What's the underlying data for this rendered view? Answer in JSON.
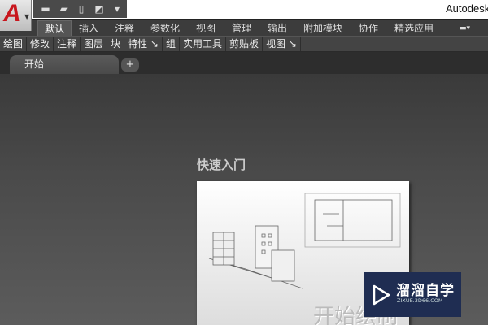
{
  "app": {
    "logo": "A",
    "title": "Autodesk"
  },
  "qat": {
    "icons": [
      "new-file-icon",
      "open-folder-icon",
      "save-icon",
      "plot-icon",
      "dropdown-icon"
    ]
  },
  "ribbon_tabs": [
    "默认",
    "插入",
    "注释",
    "参数化",
    "视图",
    "管理",
    "输出",
    "附加模块",
    "协作",
    "精选应用"
  ],
  "active_tab": "默认",
  "panels": [
    "绘图",
    "修改",
    "注释",
    "图层",
    "块",
    "特性 ↘",
    "组",
    "实用工具",
    "剪贴板",
    "视图 ↘"
  ],
  "file_tabs": {
    "current": "开始",
    "add": "+"
  },
  "start_page": {
    "heading": "快速入门",
    "card_label": "开始绘制"
  },
  "watermark": {
    "name": "溜溜自学",
    "url": "ZIXUE.3D66.COM"
  }
}
